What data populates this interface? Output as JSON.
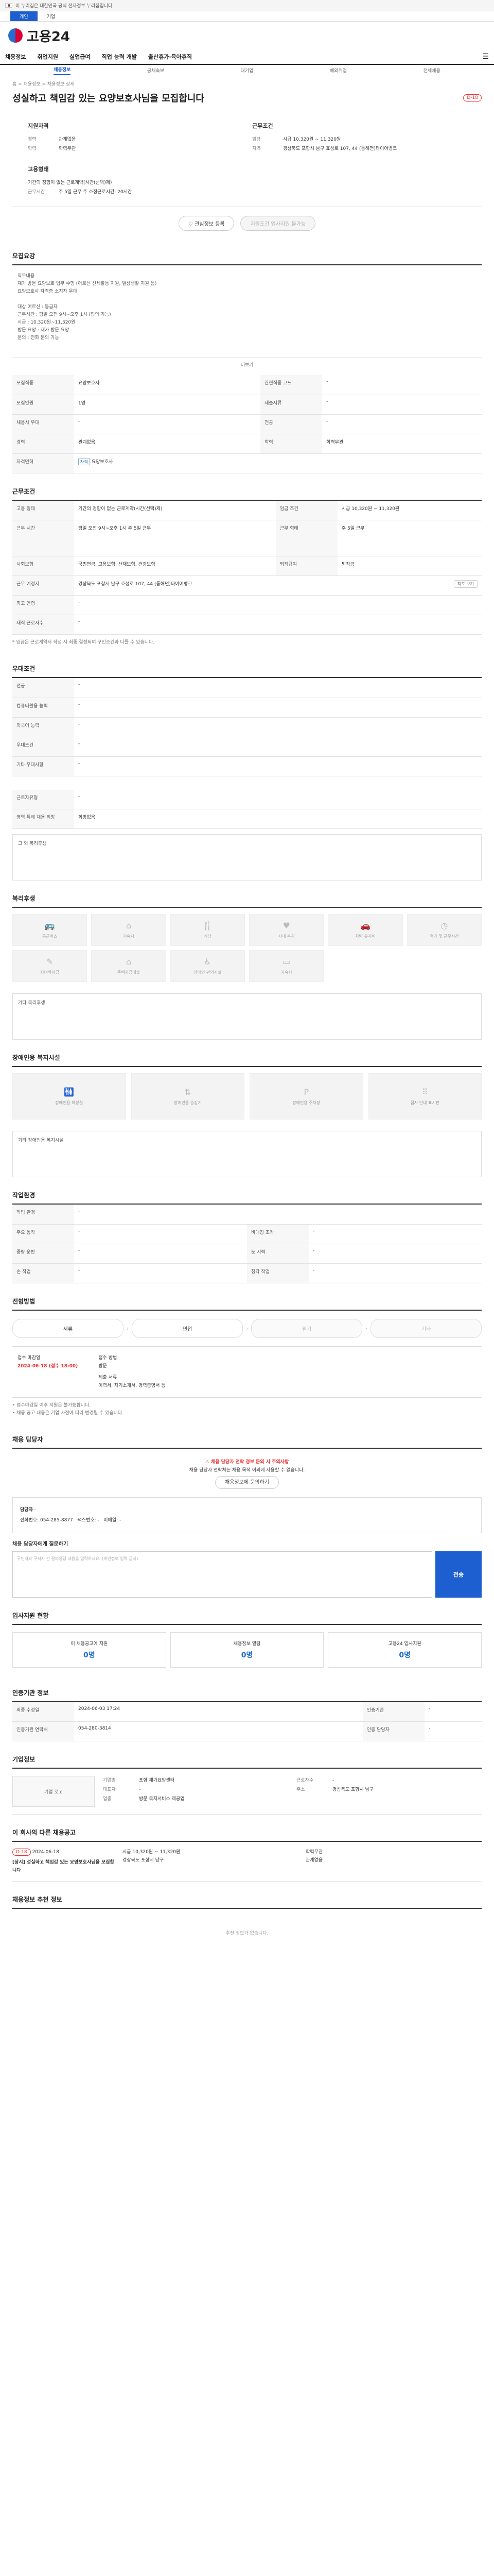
{
  "gov_banner": "이 누리집은 대한민국 공식 전자정부 누리집입니다.",
  "top_tabs": [
    "개인",
    "기업"
  ],
  "logo": "고용24",
  "gnb": [
    "채용정보",
    "취업지원",
    "실업급여",
    "직업 능력 개발",
    "출산휴가·육아휴직"
  ],
  "subnav": [
    "채용정보",
    "공채속보",
    "대기업",
    "해외취업",
    "전체채용"
  ],
  "crumb": "홈 > 채용정보 > 채용정보 상세",
  "title": "성실하고 책임감 있는 요양보호사님을 모집합니다",
  "dday": "D-18",
  "summary": {
    "left_head": "지원자격",
    "edu_k": "경력",
    "edu_v": "관계없음",
    "edu2_k": "학력",
    "edu2_v": "학력무관",
    "right_head": "근무조건",
    "pay_k": "임금",
    "pay_v": "시급 10,320원 ~ 11,320원",
    "area_k": "지역",
    "area_v": "경상북도 포항시 남구 효성로 107, 44 (동해면)타이어뱅크",
    "type_k": "고용형태",
    "type_v": "기간의 정함이 없는 근로계약(시간(선택)제)",
    "time_k": "근무시간",
    "time_v": "주 5일 근무 주 소정근로시간: 20시간"
  },
  "buttons": {
    "interest": "관심정보 등록",
    "apply": "지원조건 입사지원 불가능"
  },
  "sections": {
    "intro": "모집요강",
    "work": "근무조건",
    "prefer": "우대조건",
    "benefit": "복리후생",
    "facility": "장애인용 복지시설",
    "env": "작업환경",
    "process": "전형방법",
    "contact": "채용 담당자",
    "stats": "입사지원 현황",
    "agency": "인증기관 정보",
    "company": "기업정보",
    "other": "이 회사의 다른 채용공고",
    "recommend": "채용정보 추천 정보"
  },
  "memo": "직무내용\n재가 방문 요양보호 업무 수행 (어르신 신체활동 지원, 일상생활 지원 등)\n요양보호사 자격증 소지자 우대\n\n대상 어르신 : 등급자\n근무시간 : 평일 오전 9시~오후 1시 (협의 가능)\n시급 : 10,320원~11,320원\n방문 요양 : 재가 방문 요양\n문의 : 전화 문의 가능",
  "more": "더보기",
  "recruit_table": [
    [
      "모집직종",
      "요양보호사",
      "관련직종 코드",
      "-"
    ],
    [
      "모집인원",
      "1명",
      "제출서류",
      "-"
    ],
    [
      "채용시 우대",
      "-",
      "전공",
      "-"
    ],
    [
      "경력",
      "관계없음",
      "학력",
      "학력무관"
    ],
    [
      "자격면허",
      "요양보호사",
      "",
      ""
    ]
  ],
  "work_table": [
    [
      "고용 형태",
      "기간의 정함이 없는 근로계약(시간(선택)제)",
      "임금 조건",
      "시급 10,320원 ~ 11,320원"
    ],
    [
      "근무 시간",
      "평일 오전 9시~오후 1시 주 5일 근무",
      "근무 형태",
      "주 5일 근무"
    ],
    [
      "사회보험",
      "국민연금, 고용보험, 산재보험, 건강보험",
      "퇴직급여",
      "퇴직금"
    ],
    [
      "근무 예정지",
      "경상북도 포항시 남구 효성로 107, 44 (동해면)타이어뱅크",
      "지도 보기",
      ""
    ],
    [
      "최고 연령",
      "-",
      "",
      ""
    ],
    [
      "재직 근로자수",
      "-",
      "",
      ""
    ]
  ],
  "work_note": "* 임금은 근로계약서 작성 시 최종 결정되며 구인조건과 다를 수 있습니다.",
  "prefer_table": [
    [
      "전공",
      "-"
    ],
    [
      "컴퓨터활용 능력",
      "-"
    ],
    [
      "외국어 능력",
      "-"
    ],
    [
      "우대조건",
      "-"
    ],
    [
      "기타 우대사항",
      "-"
    ]
  ],
  "hire_table": [
    [
      "근로자유형",
      "-"
    ],
    [
      "병역 특례 채용 희망",
      "희망없음"
    ]
  ],
  "benefit_empty": "그 외 복리후생",
  "benefits": [
    "통근버스",
    "기숙사",
    "식당",
    "사내 복지",
    "차량 유지비",
    "휴가 및 근무시간"
  ],
  "benefits2": [
    "자녀학자금",
    "주택자금대출",
    "장애인 편의시설",
    "기숙사"
  ],
  "benefit_other": "기타 복리후생",
  "facility": [
    "장애인용 화장실",
    "장애인용 승강기",
    "장애인용 주차장",
    "점자 안내 표시판"
  ],
  "facility_other": "기타 장애인용 복지시설",
  "env_table": [
    [
      "작업 환경",
      "-",
      "",
      ""
    ],
    [
      "주요 동작",
      "-",
      "비대칭 조작",
      "-"
    ],
    [
      "중량 운반",
      "-",
      "눈 시력",
      "-"
    ],
    [
      "손 작업",
      "-",
      "청각 작업",
      "-"
    ]
  ],
  "process_steps": [
    "서류",
    "면접",
    "필기",
    "기타"
  ],
  "deadline": {
    "label": "접수 마감일",
    "date": "2024-06-18 (접수 18:00)",
    "method_label": "접수 방법",
    "method": "방문",
    "doc_label": "제출 서류",
    "doc": "이력서, 자기소개서, 경력증명서 등"
  },
  "deadline_notes": "• 접수마감일 이후 지원은 불가능합니다.\n• 채용 공고 내용은 기업 사정에 따라 변경될 수 있습니다.",
  "callout": {
    "hl": "채용 담당자 연락 정보 문의 시 주의사항",
    "text": "채용 담당자 연락처는 채용 목적 이외에 사용할 수 없습니다."
  },
  "callout_btn": "채용정보에 문의하기",
  "contact": {
    "name_k": "담당자",
    "name_v": "-",
    "tel_k": "전화번호",
    "tel_v": "054-285-8877",
    "fax_k": "팩스번호",
    "fax_v": "-",
    "email_k": "이메일",
    "email_v": "-"
  },
  "ask_label": "채용 담당자에게 질문하기",
  "ask_placeholder": "구인자와 구직자 간 질의응답 내용을 입력하세요. (개인정보 입력 금지)",
  "ask_send": "전송",
  "stats": [
    {
      "label": "이 채용공고에 지원",
      "v": "0명"
    },
    {
      "label": "채용정보 열람",
      "v": "0명"
    },
    {
      "label": "고용24 입사지원",
      "v": "0명"
    }
  ],
  "agency_table": [
    [
      "최종 수정일",
      "2024-06-03 17:24",
      "인증기관",
      "-"
    ],
    [
      "인증기관 연락처",
      "054-280-3814",
      "인증 담당자",
      "-"
    ]
  ],
  "company_card": "기업 로고",
  "company": {
    "name_k": "기업명",
    "name_v": "포항 재가요양센터",
    "ceo_k": "대표자",
    "ceo_v": "-",
    "ind_k": "업종",
    "ind_v": "방문 복지서비스 제공업",
    "size_k": "근로자수",
    "size_v": "-",
    "addr_k": "주소",
    "addr_v": "경상북도 포항시 남구"
  },
  "other": {
    "dday": "D-18",
    "date": "2024-06-18",
    "title": "[상시] 성실하고 책임감 있는 요양보호사님을 모집합니다",
    "pay": "시급 10,320원 ~ 11,320원",
    "loc": "경상북도 포항시 남구",
    "edu": "학력무관",
    "career": "관계없음"
  },
  "recommend_empty": "추천 정보가 없습니다."
}
